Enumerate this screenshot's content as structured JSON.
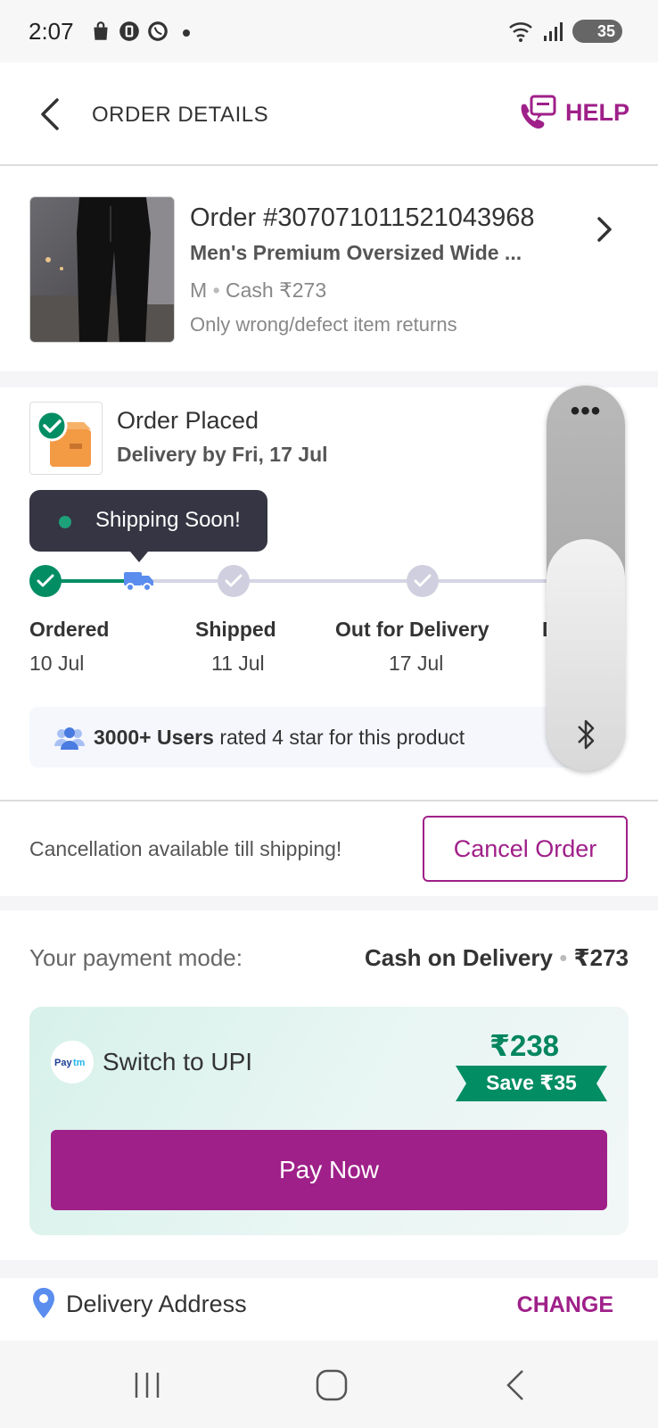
{
  "status_bar": {
    "time": "2:07",
    "battery": "35"
  },
  "header": {
    "title": "ORDER DETAILS",
    "help_label": "HELP"
  },
  "order": {
    "number": "Order #307071011521043968",
    "product_name": "Men's Premium Oversized Wide ...",
    "size": "M",
    "payment": "Cash ₹273",
    "returns_policy": "Only wrong/defect item returns"
  },
  "tracking": {
    "status_title": "Order Placed",
    "delivery_by": "Delivery by  Fri, 17 Jul",
    "tooltip": "Shipping Soon!",
    "steps": [
      {
        "label": "Ordered",
        "date": "10 Jul"
      },
      {
        "label": "Shipped",
        "date": "11 Jul"
      },
      {
        "label": "Out for Delivery",
        "date": "17 Jul"
      },
      {
        "label": "D",
        "date": ""
      }
    ],
    "rating_bold": "3000+ Users",
    "rating_rest": " rated 4 star for this product"
  },
  "cancel": {
    "note": "Cancellation available till shipping!",
    "button_label": "Cancel Order"
  },
  "payment": {
    "mode_label": "Your payment mode:",
    "mode_value": "Cash on Delivery",
    "mode_amount": "₹273",
    "upi_label": "Switch to UPI",
    "upi_brand": "Paytm",
    "upi_price": "₹238",
    "upi_save": "Save ₹35",
    "pay_now_label": "Pay Now"
  },
  "address": {
    "title": "Delivery Address",
    "change_label": "CHANGE"
  },
  "colors": {
    "brand": "#9f2089",
    "success": "#038d63",
    "tooltip_bg": "#353543",
    "truck": "#5b8def"
  }
}
